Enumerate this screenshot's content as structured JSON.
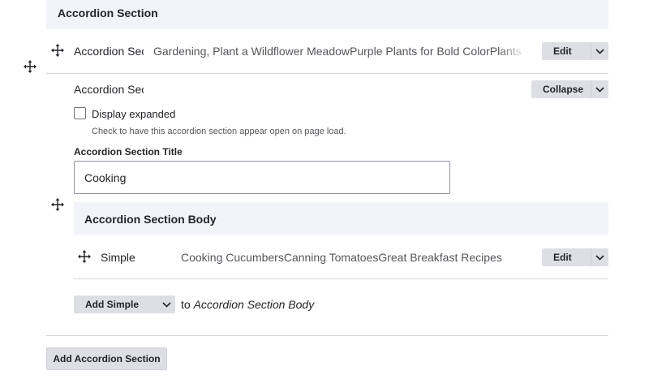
{
  "header": {
    "title": "Accordion Section"
  },
  "collapsed_item": {
    "label": "Accordion Section",
    "summary": "Gardening, Plant a Wildflower MeadowPurple Plants for Bold ColorPlants to Attract Pollinators",
    "action_label": "Edit"
  },
  "expanded_item": {
    "label": "Accordion Section",
    "action_label": "Collapse",
    "display_expanded": {
      "label": "Display expanded",
      "checked": false,
      "help": "Check to have this accordion section appear open on page load."
    },
    "title_field": {
      "label": "Accordion Section Title",
      "value": "Cooking"
    },
    "body": {
      "title": "Accordion Section Body",
      "items": [
        {
          "label": "Simple",
          "summary": "Cooking CucumbersCanning TomatoesGreat Breakfast Recipes",
          "action_label": "Edit"
        }
      ],
      "add": {
        "select_value": "Add Simple",
        "to_word": "to",
        "target": "Accordion Section Body"
      }
    }
  },
  "footer": {
    "add_button_label": "Add Accordion Section"
  },
  "icons": {
    "drag": "move-arrows-icon",
    "dropdown": "chevron-down-icon"
  },
  "colors": {
    "header_bg": "#f3f4f9",
    "button_bg": "#dedfe4",
    "text": "#232429"
  }
}
